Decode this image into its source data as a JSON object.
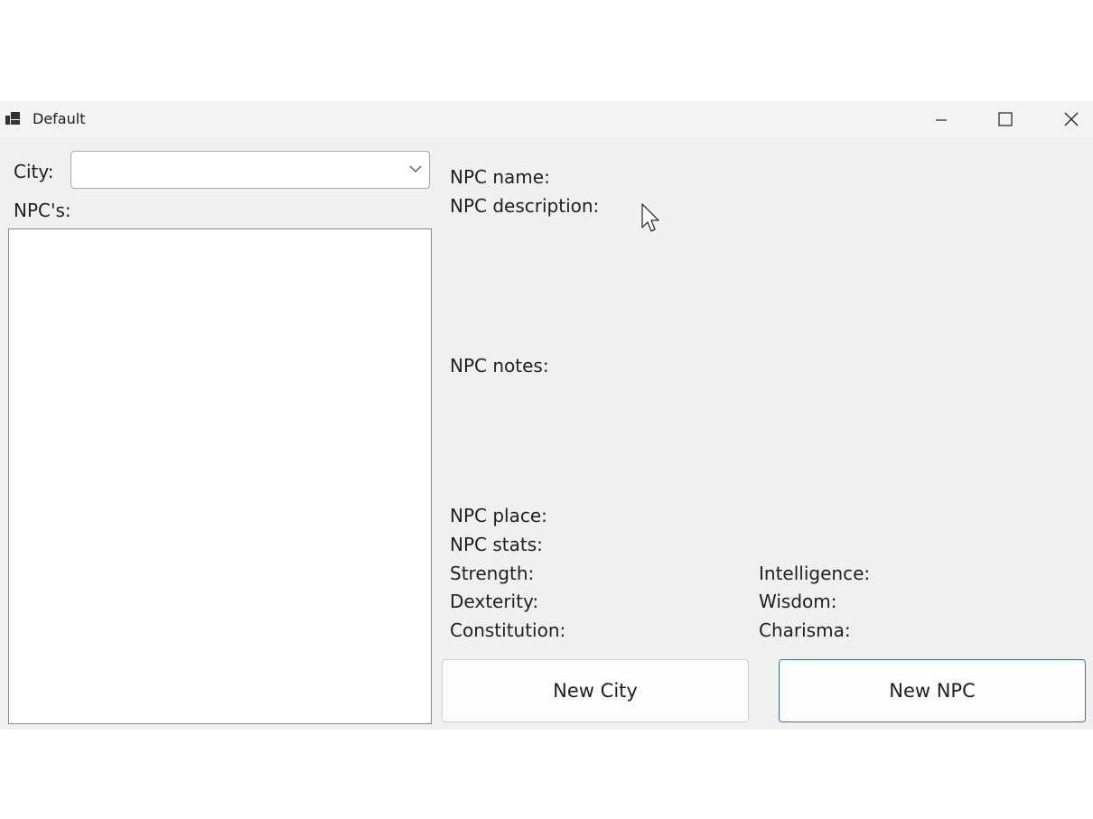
{
  "window": {
    "title": "Default",
    "controls": {
      "minimize": "minimize-icon",
      "maximize": "maximize-icon",
      "close": "close-icon"
    }
  },
  "left": {
    "city_label": "City:",
    "city_value": "",
    "npcs_label": "NPC's:",
    "npcs": []
  },
  "details": {
    "name_label": "NPC name:",
    "description_label": "NPC description:",
    "notes_label": "NPC notes:",
    "place_label": "NPC place:",
    "stats_label": "NPC stats:",
    "stats": {
      "strength": "Strength:",
      "dexterity": "Dexterity:",
      "constitution": "Constitution:",
      "intelligence": "Intelligence:",
      "wisdom": "Wisdom:",
      "charisma": "Charisma:"
    }
  },
  "buttons": {
    "new_city": "New City",
    "new_npc": "New NPC"
  },
  "colors": {
    "window_bg": "#f0f0f0",
    "accent_border": "#3a6ebf"
  }
}
